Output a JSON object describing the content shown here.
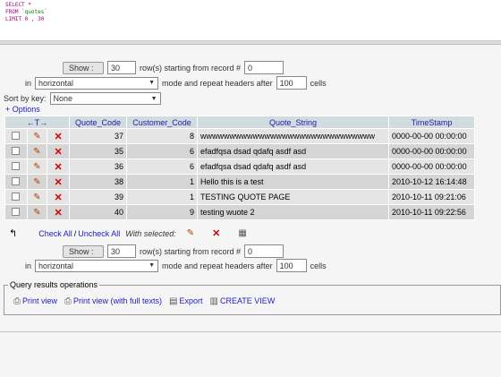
{
  "sql": {
    "line1": "SELECT *",
    "line2_kw": "FROM",
    "line2_str": "`quotes`",
    "line3": "LIMIT 0 , 30"
  },
  "nav_top": {
    "show_label": "Show :",
    "rows_value": "30",
    "rows_text": "row(s) starting from record #",
    "start_value": "0",
    "in_text": "in",
    "mode_value": "horizontal",
    "mode_text": "mode and repeat headers after",
    "repeat_value": "100",
    "cells_text": "cells"
  },
  "sort": {
    "label": "Sort by key:",
    "value": "None"
  },
  "options_link": "+ Options",
  "table": {
    "headers": [
      "Quote_Code",
      "Customer_Code",
      "Quote_String",
      "TimeStamp"
    ],
    "rows": [
      {
        "quote_code": "37",
        "customer_code": "8",
        "quote_string": "wwwwwwwwwwwwwwwwwwwwwwwwwwwwww",
        "timestamp": "0000-00-00 00:00:00"
      },
      {
        "quote_code": "35",
        "customer_code": "6",
        "quote_string": "efadfqsa dsad qdafq asdf asd",
        "timestamp": "0000-00-00 00:00:00"
      },
      {
        "quote_code": "36",
        "customer_code": "6",
        "quote_string": "efadfqsa dsad qdafq asdf asd",
        "timestamp": "0000-00-00 00:00:00"
      },
      {
        "quote_code": "38",
        "customer_code": "1",
        "quote_string": "Hello this is a test",
        "timestamp": "2010-10-12 16:14:48"
      },
      {
        "quote_code": "39",
        "customer_code": "1",
        "quote_string": "TESTING QUOTE PAGE",
        "timestamp": "2010-10-11 09:21:06"
      },
      {
        "quote_code": "40",
        "customer_code": "9",
        "quote_string": "testing wuote 2",
        "timestamp": "2010-10-11 09:22:56"
      }
    ]
  },
  "check_all": {
    "check_all_label": "Check All",
    "separator": "/",
    "uncheck_all_label": "Uncheck All",
    "with_selected": "With selected:"
  },
  "nav_bottom": {
    "show_label": "Show :",
    "rows_value": "30",
    "rows_text": "row(s) starting from record #",
    "start_value": "0",
    "in_text": "in",
    "mode_value": "horizontal",
    "mode_text": "mode and repeat headers after",
    "repeat_value": "100",
    "cells_text": "cells"
  },
  "qro": {
    "legend": "Query results operations",
    "print_view": "Print view",
    "print_view_full": "Print view (with full texts)",
    "export": "Export",
    "create_view": "CREATE VIEW"
  },
  "colors": {
    "link": "#2020c0",
    "header_bg": "#d0dce0",
    "delete_red": "#d00000"
  }
}
